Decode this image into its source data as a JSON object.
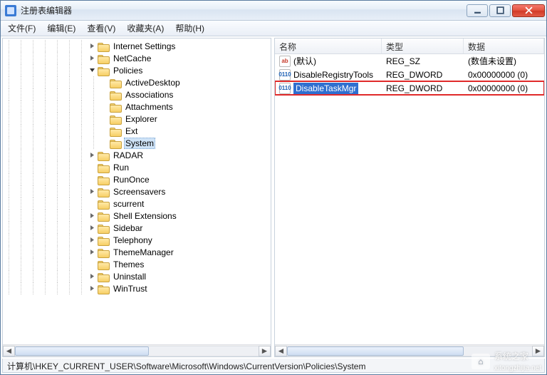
{
  "window": {
    "title": "注册表编辑器"
  },
  "menu": {
    "file": "文件(F)",
    "edit": "编辑(E)",
    "view": "查看(V)",
    "favorites": "收藏夹(A)",
    "help": "帮助(H)"
  },
  "tree": {
    "items": [
      {
        "depth": 7,
        "toggle": "closed",
        "label": "Internet Settings"
      },
      {
        "depth": 7,
        "toggle": "closed",
        "label": "NetCache"
      },
      {
        "depth": 7,
        "toggle": "open",
        "label": "Policies"
      },
      {
        "depth": 8,
        "toggle": "none",
        "label": "ActiveDesktop"
      },
      {
        "depth": 8,
        "toggle": "none",
        "label": "Associations"
      },
      {
        "depth": 8,
        "toggle": "none",
        "label": "Attachments"
      },
      {
        "depth": 8,
        "toggle": "none",
        "label": "Explorer"
      },
      {
        "depth": 8,
        "toggle": "none",
        "label": "Ext"
      },
      {
        "depth": 8,
        "toggle": "none",
        "label": "System",
        "selected": true
      },
      {
        "depth": 7,
        "toggle": "closed",
        "label": "RADAR"
      },
      {
        "depth": 7,
        "toggle": "none",
        "label": "Run"
      },
      {
        "depth": 7,
        "toggle": "none",
        "label": "RunOnce"
      },
      {
        "depth": 7,
        "toggle": "closed",
        "label": "Screensavers"
      },
      {
        "depth": 7,
        "toggle": "none",
        "label": "scurrent"
      },
      {
        "depth": 7,
        "toggle": "closed",
        "label": "Shell Extensions"
      },
      {
        "depth": 7,
        "toggle": "closed",
        "label": "Sidebar"
      },
      {
        "depth": 7,
        "toggle": "closed",
        "label": "Telephony"
      },
      {
        "depth": 7,
        "toggle": "closed",
        "label": "ThemeManager"
      },
      {
        "depth": 7,
        "toggle": "none",
        "label": "Themes"
      },
      {
        "depth": 7,
        "toggle": "closed",
        "label": "Uninstall"
      },
      {
        "depth": 7,
        "toggle": "closed",
        "label": "WinTrust"
      }
    ]
  },
  "list": {
    "columns": {
      "name": "名称",
      "type": "类型",
      "data": "数据"
    },
    "rows": [
      {
        "icon": "str",
        "name": "(默认)",
        "type": "REG_SZ",
        "data": "(数值未设置)",
        "selected": false,
        "highlight": false
      },
      {
        "icon": "bin",
        "name": "DisableRegistryTools",
        "type": "REG_DWORD",
        "data": "0x00000000 (0)",
        "selected": false,
        "highlight": false
      },
      {
        "icon": "bin",
        "name": "DisableTaskMgr",
        "type": "REG_DWORD",
        "data": "0x00000000 (0)",
        "selected": true,
        "highlight": true
      }
    ]
  },
  "status": {
    "path": "计算机\\HKEY_CURRENT_USER\\Software\\Microsoft\\Windows\\CurrentVersion\\Policies\\System"
  },
  "watermark": {
    "text": "系统之家",
    "url": "xitongzhijia.net"
  }
}
